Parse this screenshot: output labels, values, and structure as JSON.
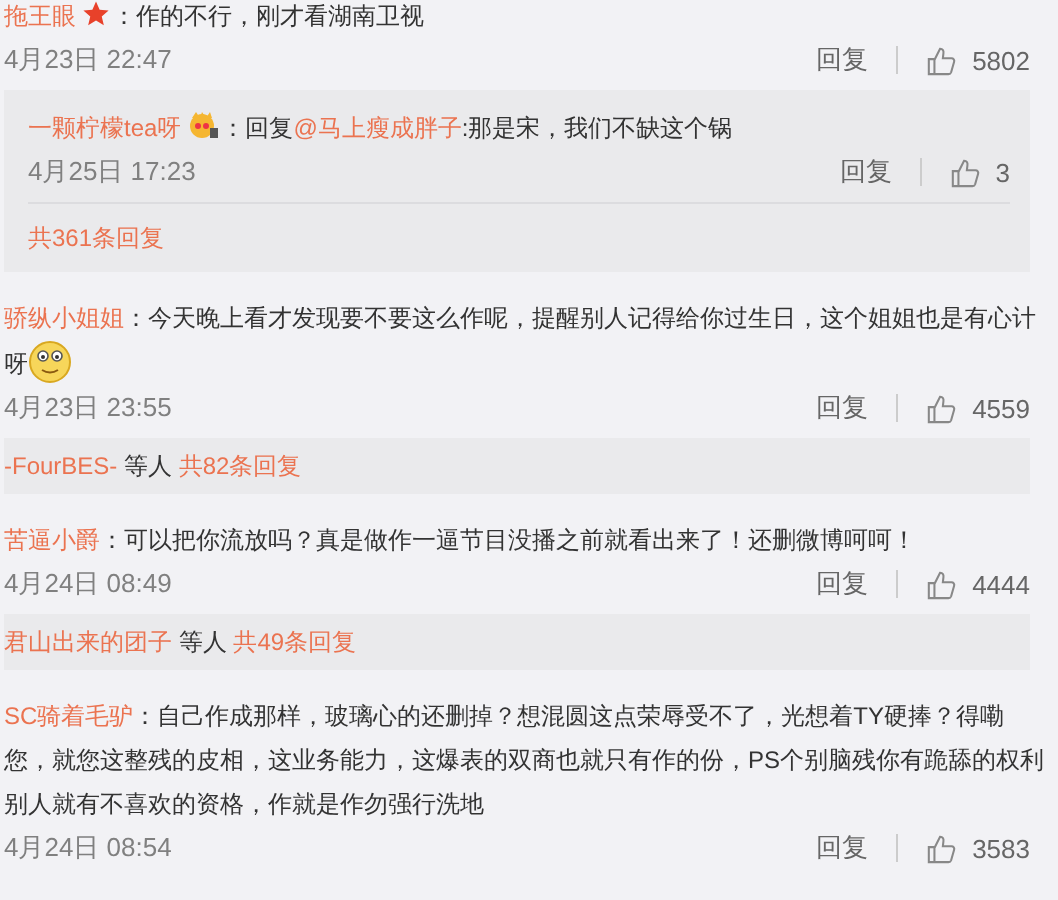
{
  "comments": [
    {
      "user": "拖王眼",
      "badge": {
        "kind": "star"
      },
      "text": "：作的不行，刚才看湖南卫视",
      "emoji": false,
      "time": "4月23日 22:47",
      "reply_label": "回复",
      "likes": "5802",
      "thread": {
        "kind": "reply",
        "user": "一颗柠檬tea呀",
        "badge": {
          "kind": "face"
        },
        "prefix": "：回复",
        "mention": "@马上瘦成胖子",
        "text": ":那是宋，我们不缺这个锅",
        "time": "4月25日 17:23",
        "reply_label": "回复",
        "likes": "3",
        "total": "共361条回复"
      }
    },
    {
      "user": "骄纵小姐姐",
      "text": "：今天晚上看才发现要不要这么作呢，提醒别人记得给你过生日，这个姐姐也是有心计呀",
      "emoji": true,
      "time": "4月23日 23:55",
      "reply_label": "回复",
      "likes": "4559",
      "thread": {
        "kind": "summary",
        "user": "-FourBES-",
        "others": "等人",
        "total": "共82条回复"
      }
    },
    {
      "user": "苦逼小爵",
      "text": "：可以把你流放吗？真是做作一逼节目没播之前就看出来了！还删微博呵呵！",
      "emoji": false,
      "time": "4月24日 08:49",
      "reply_label": "回复",
      "likes": "4444",
      "thread": {
        "kind": "summary",
        "user": "君山出来的团子",
        "others": "等人",
        "total": "共49条回复"
      }
    },
    {
      "user": "SC骑着毛驴",
      "text": "：自己作成那样，玻璃心的还删掉？想混圆这点荣辱受不了，光想着TY硬捧？得嘞您，就您这整残的皮相，这业务能力，这爆表的双商也就只有作的份，PS个别脑残你有跪舔的权利别人就有不喜欢的资格，作就是作勿强行洗地",
      "emoji": false,
      "time": "4月24日 08:54",
      "reply_label": "回复",
      "likes": "3583"
    }
  ]
}
